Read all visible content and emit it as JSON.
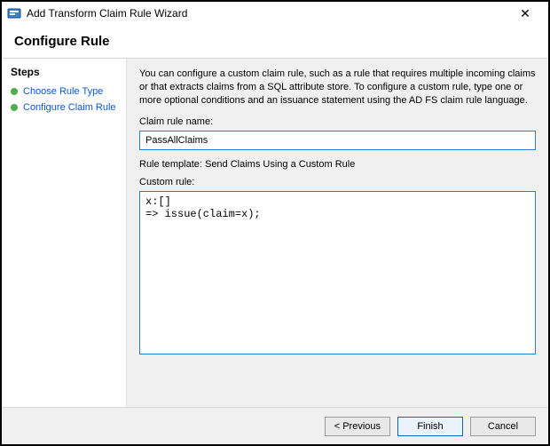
{
  "window": {
    "title": "Add Transform Claim Rule Wizard",
    "close_label": "✕"
  },
  "header": {
    "title": "Configure Rule"
  },
  "sidebar": {
    "title": "Steps",
    "items": [
      {
        "label": "Choose Rule Type"
      },
      {
        "label": "Configure Claim Rule"
      }
    ]
  },
  "content": {
    "description": "You can configure a custom claim rule, such as a rule that requires multiple incoming claims or that extracts claims from a SQL attribute store. To configure a custom rule, type one or more optional conditions and an issuance statement using the AD FS claim rule language.",
    "name_label": "Claim rule name:",
    "name_value": "PassAllClaims",
    "template_label": "Rule template: Send Claims Using a Custom Rule",
    "custom_label": "Custom rule:",
    "custom_value": "x:[]\n=> issue(claim=x);"
  },
  "footer": {
    "previous": "< Previous",
    "finish": "Finish",
    "cancel": "Cancel"
  }
}
